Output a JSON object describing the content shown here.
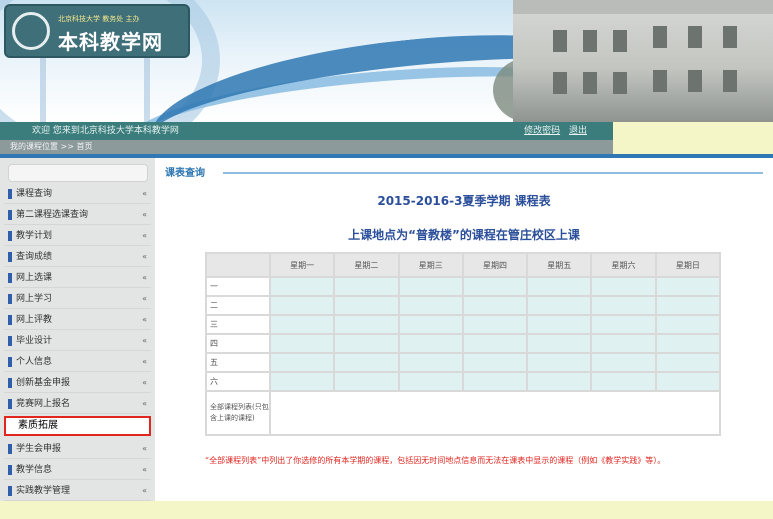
{
  "header": {
    "university": "北京科技大学 教务处 主办",
    "title": "本科教学网",
    "welcome": "欢迎 您来到北京科技大学本科教学网",
    "links": [
      "修改密码",
      "退出"
    ],
    "breadcrumb": "我的课程位置 >> 首页"
  },
  "sidebar": {
    "items": [
      {
        "label": "课程查询",
        "active": false
      },
      {
        "label": "第二课程选课查询",
        "active": false
      },
      {
        "label": "教学计划",
        "active": false
      },
      {
        "label": "查询成绩",
        "active": false
      },
      {
        "label": "网上选课",
        "active": false
      },
      {
        "label": "网上学习",
        "active": false
      },
      {
        "label": "网上评教",
        "active": false
      },
      {
        "label": "毕业设计",
        "active": false
      },
      {
        "label": "个人信息",
        "active": false
      },
      {
        "label": "创新基金申报",
        "active": false
      },
      {
        "label": "竞赛网上报名",
        "active": false
      },
      {
        "label": "素质拓展",
        "active": true
      },
      {
        "label": "学生会申报",
        "active": false
      },
      {
        "label": "教学信息",
        "active": false
      },
      {
        "label": "实践教学管理",
        "active": false
      }
    ]
  },
  "main": {
    "panel_title": "课表查询",
    "term_title": "2015-2016-3夏季学期 课程表",
    "sub_title": "上课地点为“普教楼”的课程在管庄校区上课",
    "columns": [
      "",
      "星期一",
      "星期二",
      "星期三",
      "星期四",
      "星期五",
      "星期六",
      "星期日"
    ],
    "rows": [
      "一",
      "二",
      "三",
      "四",
      "五",
      "六"
    ],
    "last_row_label": "全部课程列表(只包含上课的课程)",
    "note": "“全部课程列表”中列出了你选修的所有本学期的课程，包括因无时间地点信息而无法在课表中显示的课程（例如《教学实践》等）。"
  },
  "colors": {
    "accent": "#2f78b3",
    "teal_bar": "#3b7c7d",
    "cell_fill": "#dff2f1",
    "highlight": "#e0261f"
  }
}
